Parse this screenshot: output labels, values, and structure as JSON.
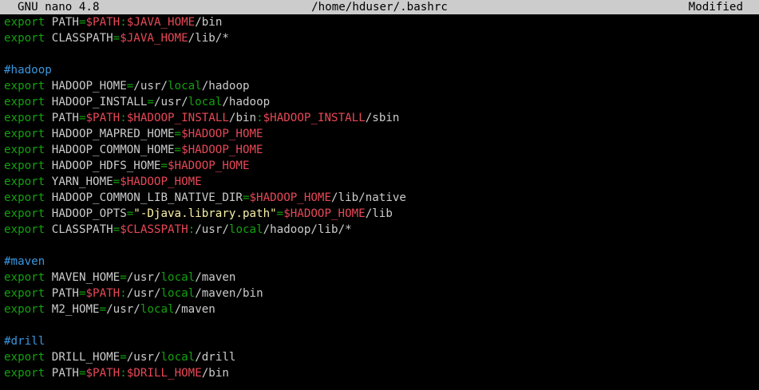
{
  "titlebar": {
    "app": "GNU nano 4.8",
    "file": "/home/hduser/.bashrc",
    "status": "Modified"
  },
  "lines": [
    [
      [
        "kw",
        "export"
      ],
      [
        "txt",
        " PATH"
      ],
      [
        "op",
        "="
      ],
      [
        "var",
        "$PATH"
      ],
      [
        "op",
        ":"
      ],
      [
        "var",
        "$JAVA_HOME"
      ],
      [
        "txt",
        "/bin"
      ]
    ],
    [
      [
        "kw",
        "export"
      ],
      [
        "txt",
        " CLASSPATH"
      ],
      [
        "op",
        "="
      ],
      [
        "var",
        "$JAVA_HOME"
      ],
      [
        "txt",
        "/lib/*"
      ]
    ],
    [],
    [
      [
        "cmt",
        "#hadoop"
      ]
    ],
    [
      [
        "kw",
        "export"
      ],
      [
        "txt",
        " HADOOP_HOME"
      ],
      [
        "op",
        "="
      ],
      [
        "txt",
        "/usr/"
      ],
      [
        "loc",
        "local"
      ],
      [
        "txt",
        "/hadoop"
      ]
    ],
    [
      [
        "kw",
        "export"
      ],
      [
        "txt",
        " HADOOP_INSTALL"
      ],
      [
        "op",
        "="
      ],
      [
        "txt",
        "/usr/"
      ],
      [
        "loc",
        "local"
      ],
      [
        "txt",
        "/hadoop"
      ]
    ],
    [
      [
        "kw",
        "export"
      ],
      [
        "txt",
        " PATH"
      ],
      [
        "op",
        "="
      ],
      [
        "var",
        "$PATH"
      ],
      [
        "op",
        ":"
      ],
      [
        "var",
        "$HADOOP_INSTALL"
      ],
      [
        "txt",
        "/bin"
      ],
      [
        "op",
        ":"
      ],
      [
        "var",
        "$HADOOP_INSTALL"
      ],
      [
        "txt",
        "/sbin"
      ]
    ],
    [
      [
        "kw",
        "export"
      ],
      [
        "txt",
        " HADOOP_MAPRED_HOME"
      ],
      [
        "op",
        "="
      ],
      [
        "var",
        "$HADOOP_HOME"
      ]
    ],
    [
      [
        "kw",
        "export"
      ],
      [
        "txt",
        " HADOOP_COMMON_HOME"
      ],
      [
        "op",
        "="
      ],
      [
        "var",
        "$HADOOP_HOME"
      ]
    ],
    [
      [
        "kw",
        "export"
      ],
      [
        "txt",
        " HADOOP_HDFS_HOME"
      ],
      [
        "op",
        "="
      ],
      [
        "var",
        "$HADOOP_HOME"
      ]
    ],
    [
      [
        "kw",
        "export"
      ],
      [
        "txt",
        " YARN_HOME"
      ],
      [
        "op",
        "="
      ],
      [
        "var",
        "$HADOOP_HOME"
      ]
    ],
    [
      [
        "kw",
        "export"
      ],
      [
        "txt",
        " HADOOP_COMMON_LIB_NATIVE_DIR"
      ],
      [
        "op",
        "="
      ],
      [
        "var",
        "$HADOOP_HOME"
      ],
      [
        "txt",
        "/lib/native"
      ]
    ],
    [
      [
        "kw",
        "export"
      ],
      [
        "txt",
        " HADOOP_OPTS"
      ],
      [
        "op",
        "="
      ],
      [
        "str",
        "\"-Djava.library.path\""
      ],
      [
        "op",
        "="
      ],
      [
        "var",
        "$HADOOP_HOME"
      ],
      [
        "txt",
        "/lib"
      ]
    ],
    [
      [
        "kw",
        "export"
      ],
      [
        "txt",
        " CLASSPATH"
      ],
      [
        "op",
        "="
      ],
      [
        "var",
        "$CLASSPATH"
      ],
      [
        "op",
        ":"
      ],
      [
        "txt",
        "/usr/"
      ],
      [
        "loc",
        "local"
      ],
      [
        "txt",
        "/hadoop/lib/*"
      ]
    ],
    [],
    [
      [
        "cmt",
        "#maven"
      ]
    ],
    [
      [
        "kw",
        "export"
      ],
      [
        "txt",
        " MAVEN_HOME"
      ],
      [
        "op",
        "="
      ],
      [
        "txt",
        "/usr/"
      ],
      [
        "loc",
        "local"
      ],
      [
        "txt",
        "/maven"
      ]
    ],
    [
      [
        "kw",
        "export"
      ],
      [
        "txt",
        " PATH"
      ],
      [
        "op",
        "="
      ],
      [
        "var",
        "$PATH"
      ],
      [
        "op",
        ":"
      ],
      [
        "txt",
        "/usr/"
      ],
      [
        "loc",
        "local"
      ],
      [
        "txt",
        "/maven/bin"
      ]
    ],
    [
      [
        "kw",
        "export"
      ],
      [
        "txt",
        " M2_HOME"
      ],
      [
        "op",
        "="
      ],
      [
        "txt",
        "/usr/"
      ],
      [
        "loc",
        "local"
      ],
      [
        "txt",
        "/maven"
      ]
    ],
    [],
    [
      [
        "cmt",
        "#drill"
      ]
    ],
    [
      [
        "kw",
        "export"
      ],
      [
        "txt",
        " DRILL_HOME"
      ],
      [
        "op",
        "="
      ],
      [
        "txt",
        "/usr/"
      ],
      [
        "loc",
        "local"
      ],
      [
        "txt",
        "/drill"
      ]
    ],
    [
      [
        "kw",
        "export"
      ],
      [
        "txt",
        " PATH"
      ],
      [
        "op",
        "="
      ],
      [
        "var",
        "$PATH"
      ],
      [
        "op",
        ":"
      ],
      [
        "var",
        "$DRILL_HOME"
      ],
      [
        "txt",
        "/bin"
      ]
    ]
  ]
}
